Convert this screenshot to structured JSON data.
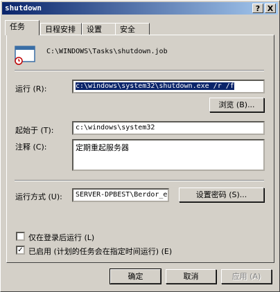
{
  "window": {
    "title": "shutdown"
  },
  "titlebar_buttons": {
    "help": "?",
    "close": "X"
  },
  "tabs": [
    {
      "label": "任务"
    },
    {
      "label": "日程安排"
    },
    {
      "label": "设置"
    },
    {
      "label": "安全"
    }
  ],
  "task": {
    "path": "C:\\WINDOWS\\Tasks\\shutdown.job",
    "run_label": "运行 (R):",
    "run_value": "c:\\windows\\system32\\shutdown.exe /r /f",
    "browse_label": "浏览 (B)...",
    "start_in_label": "起始于 (T):",
    "start_in_value": "c:\\windows\\system32",
    "comment_label": "注释 (C):",
    "comment_value": "定期重起服务器",
    "run_as_label": "运行方式 (U):",
    "run_as_value": "SERVER-DPBEST\\Berdor_ei",
    "set_password_label": "设置密码 (S)...",
    "logon_only_label": "仅在登录后运行 (L)",
    "logon_only_checked": false,
    "enabled_label": "已启用 (计划的任务会在指定时间运行) (E)",
    "enabled_checked": true
  },
  "footer": {
    "ok_label": "确定",
    "cancel_label": "取消",
    "apply_label": "应用 (A)"
  }
}
